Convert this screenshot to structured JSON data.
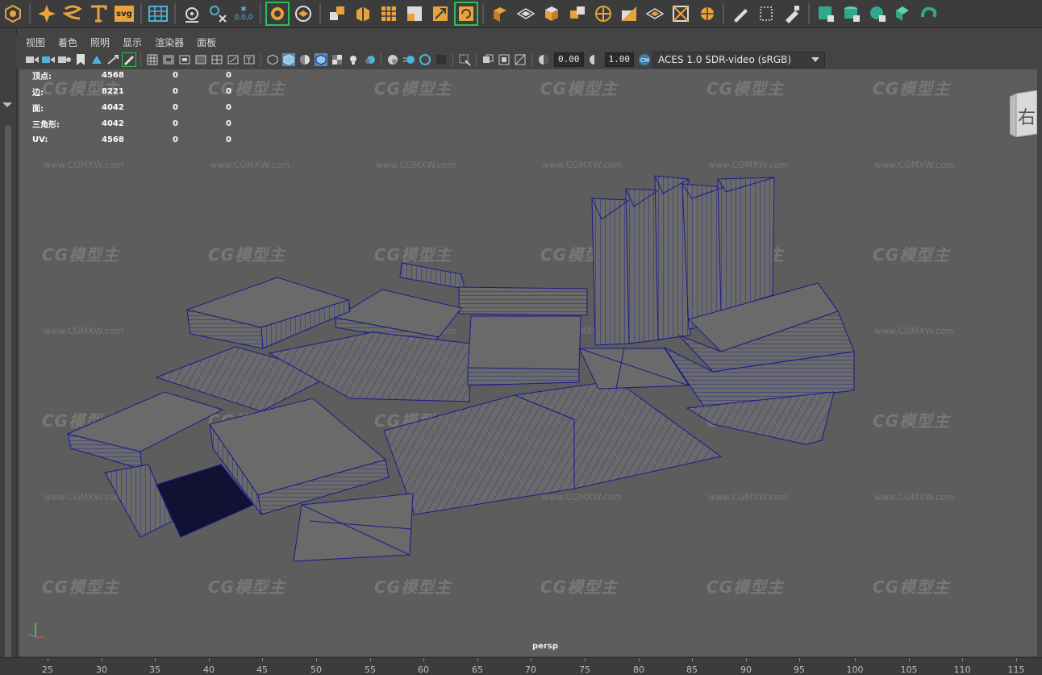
{
  "menu": [
    "视图",
    "着色",
    "照明",
    "显示",
    "渲染器",
    "面板"
  ],
  "stats": [
    {
      "label": "顶点:",
      "v1": "4568",
      "v2": "0",
      "v3": "0"
    },
    {
      "label": "边:",
      "v1": "8221",
      "v2": "0",
      "v3": "0"
    },
    {
      "label": "面:",
      "v1": "4042",
      "v2": "0",
      "v3": "0"
    },
    {
      "label": "三角形:",
      "v1": "4042",
      "v2": "0",
      "v3": "0"
    },
    {
      "label": "UV:",
      "v1": "4568",
      "v2": "0",
      "v3": "0"
    }
  ],
  "toolbar": {
    "exposure": "0.00",
    "gamma": "1.00",
    "colorspace": "ACES 1.0 SDR-video (sRGB)",
    "svg_label": "svg",
    "coords_label": "0,0,0"
  },
  "viewport": {
    "camera": "persp",
    "viewcube_label": "右"
  },
  "watermark": {
    "logo": "CG模型主",
    "url": "www.CGMXW.com"
  },
  "ruler": [
    "25",
    "30",
    "35",
    "40",
    "45",
    "50",
    "55",
    "60",
    "65",
    "70",
    "75",
    "80",
    "85",
    "90",
    "95",
    "100",
    "105",
    "110",
    "115"
  ],
  "colors": {
    "shelf_icon": "#e8a33c",
    "shelf_icon_teal": "#2fa88c",
    "wire": "#1a1a8c",
    "viewport_bg": "#5d5d5d",
    "mesh_fill": "#6a6a6a"
  }
}
